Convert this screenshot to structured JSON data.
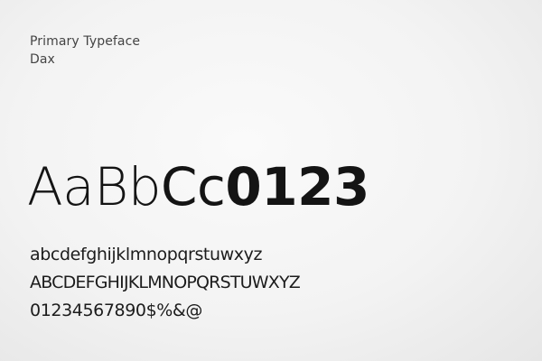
{
  "header": {
    "label": "Primary Typeface",
    "typeface_name": "Dax"
  },
  "specimen": {
    "light": "AaBb",
    "regular": "Cc",
    "medium": "01",
    "bold": "23"
  },
  "character_set": {
    "lowercase": "abcdefghijklmnopqrstuwxyz",
    "uppercase": "ABCDEFGHIJKLMNOPQRSTUWXYZ",
    "numerals_symbols": "01234567890$%&@"
  }
}
